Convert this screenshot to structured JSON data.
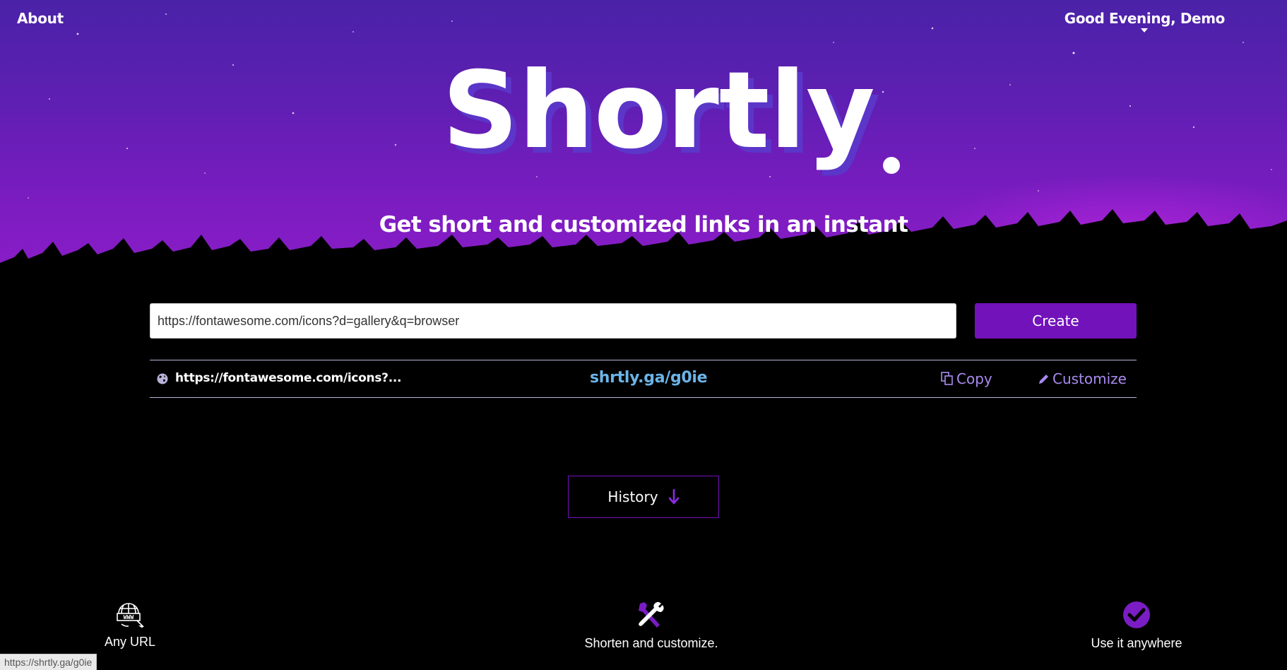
{
  "nav": {
    "about_label": "About",
    "greeting": "Good Evening, Demo"
  },
  "hero": {
    "logo_text": "Shortly",
    "tagline": "Get short and customized links in an instant"
  },
  "form": {
    "url_value": "https://fontawesome.com/icons?d=gallery&q=browser",
    "create_label": "Create"
  },
  "result": {
    "long_url": "https://fontawesome.com/icons?...",
    "short_url": "shrtly.ga/g0ie",
    "copy_label": "Copy",
    "customize_label": "Customize"
  },
  "history": {
    "label": "History"
  },
  "features": [
    {
      "icon": "www-globe-icon",
      "label": "Any URL"
    },
    {
      "icon": "tools-icon",
      "label": "Shorten and customize."
    },
    {
      "icon": "check-circle-icon",
      "label": "Use it anywhere"
    }
  ],
  "statusbar": {
    "url": "https://shrtly.ga/g0ie"
  },
  "colors": {
    "accent": "#7212bb",
    "short_link": "#6cb4e8",
    "action_link": "#a98bf0"
  }
}
